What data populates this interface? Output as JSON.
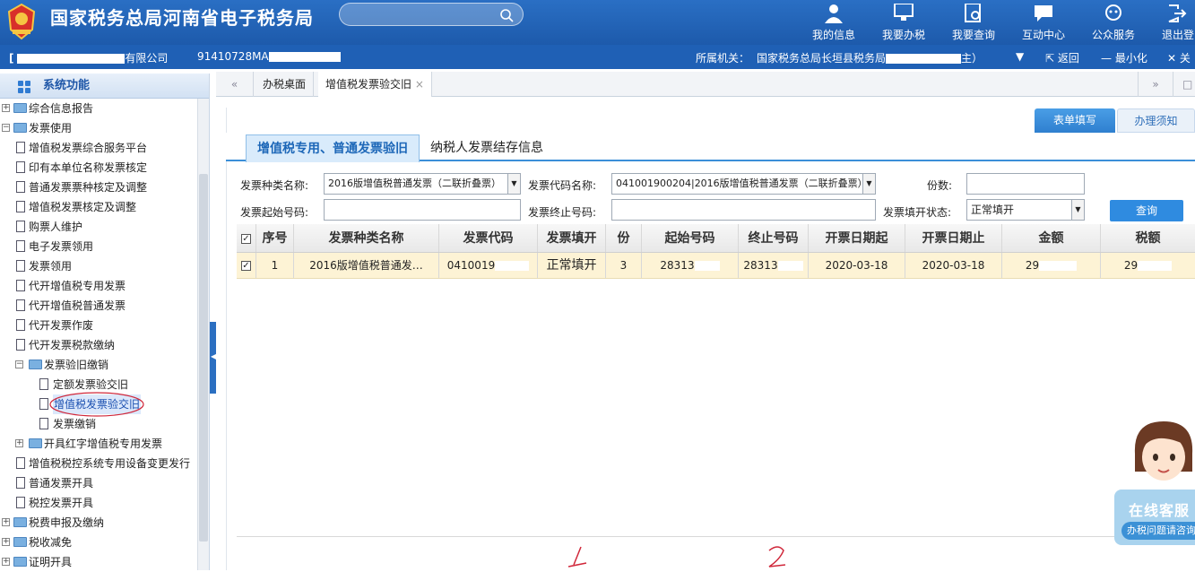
{
  "header": {
    "site_title": "国家税务总局河南省电子税务局",
    "nav": [
      {
        "label": "我的信息",
        "icon": "user-icon"
      },
      {
        "label": "我要办税",
        "icon": "monitor-icon"
      },
      {
        "label": "我要查询",
        "icon": "query-icon"
      },
      {
        "label": "互动中心",
        "icon": "chat-icon"
      },
      {
        "label": "公众服务",
        "icon": "service-icon"
      },
      {
        "label": "退出登",
        "icon": "logout-icon"
      }
    ]
  },
  "subbar": {
    "company_bracket": "[",
    "company_suffix": "有限公司",
    "tax_id_prefix": "91410728MA",
    "office_label": "所属机关：",
    "office_value": "国家税务总局长垣县税务局",
    "office_close": "主）",
    "back_label": "返回",
    "minimize_label": "最小化",
    "close_label": "关"
  },
  "sidebar": {
    "title": "系统功能",
    "items": [
      {
        "label": "综合信息报告"
      },
      {
        "label": "发票使用"
      },
      {
        "label": "增值税发票综合服务平台"
      },
      {
        "label": "印有本单位名称发票核定"
      },
      {
        "label": "普通发票票种核定及调整"
      },
      {
        "label": "增值税发票核定及调整"
      },
      {
        "label": "购票人维护"
      },
      {
        "label": "电子发票领用"
      },
      {
        "label": "发票领用"
      },
      {
        "label": "代开增值税专用发票"
      },
      {
        "label": "代开增值税普通发票"
      },
      {
        "label": "代开发票作废"
      },
      {
        "label": "代开发票税款缴纳"
      },
      {
        "label": "发票验旧缴销"
      },
      {
        "label": "定额发票验交旧"
      },
      {
        "label": "增值税发票验交旧"
      },
      {
        "label": "发票缴销"
      },
      {
        "label": "开具红字增值税专用发票"
      },
      {
        "label": "增值税税控系统专用设备变更发行"
      },
      {
        "label": "普通发票开具"
      },
      {
        "label": "税控发票开具"
      },
      {
        "label": "税费申报及缴纳"
      },
      {
        "label": "税收减免"
      },
      {
        "label": "证明开具"
      }
    ]
  },
  "tabs": {
    "home": "办税桌面",
    "active": "增值税发票验交旧"
  },
  "form_tabs": {
    "fill": "表单填写",
    "notice": "办理须知"
  },
  "biz_tabs": {
    "tab1": "增值税专用、普通发票验旧",
    "tab2": "纳税人发票结存信息"
  },
  "form": {
    "type_label": "发票种类名称:",
    "type_value": "2016版增值税普通发票（二联折叠票）",
    "code_label": "发票代码名称:",
    "code_value": "041001900204|2016版增值税普通发票（二联折叠票）",
    "count_label": "份数:",
    "count_value": "",
    "start_label": "发票起始号码:",
    "start_value": "",
    "end_label": "发票终止号码:",
    "end_value": "",
    "status_label": "发票填开状态:",
    "status_value": "正常填开",
    "query_button": "查询"
  },
  "grid": {
    "headers": [
      "序号",
      "发票种类名称",
      "发票代码",
      "发票填开",
      "份",
      "起始号码",
      "终止号码",
      "开票日期起",
      "开票日期止",
      "金额",
      "税额"
    ],
    "rows": [
      {
        "checked": "✓",
        "seq": "1",
        "type": "2016版增值税普通发…",
        "code": "0410019",
        "status": "正常填开",
        "count": "3",
        "start": "28313",
        "end": "28313",
        "date_from": "2020-03-18",
        "date_to": "2020-03-18",
        "amount": "29",
        "tax": "29"
      }
    ]
  },
  "chat": {
    "title": "在线客服",
    "subtitle": "办税问题请咨询"
  },
  "colors": {
    "header_blue": "#1d5aab",
    "accent_blue": "#3b8fd8",
    "row_highlight": "#fdf3d5"
  }
}
